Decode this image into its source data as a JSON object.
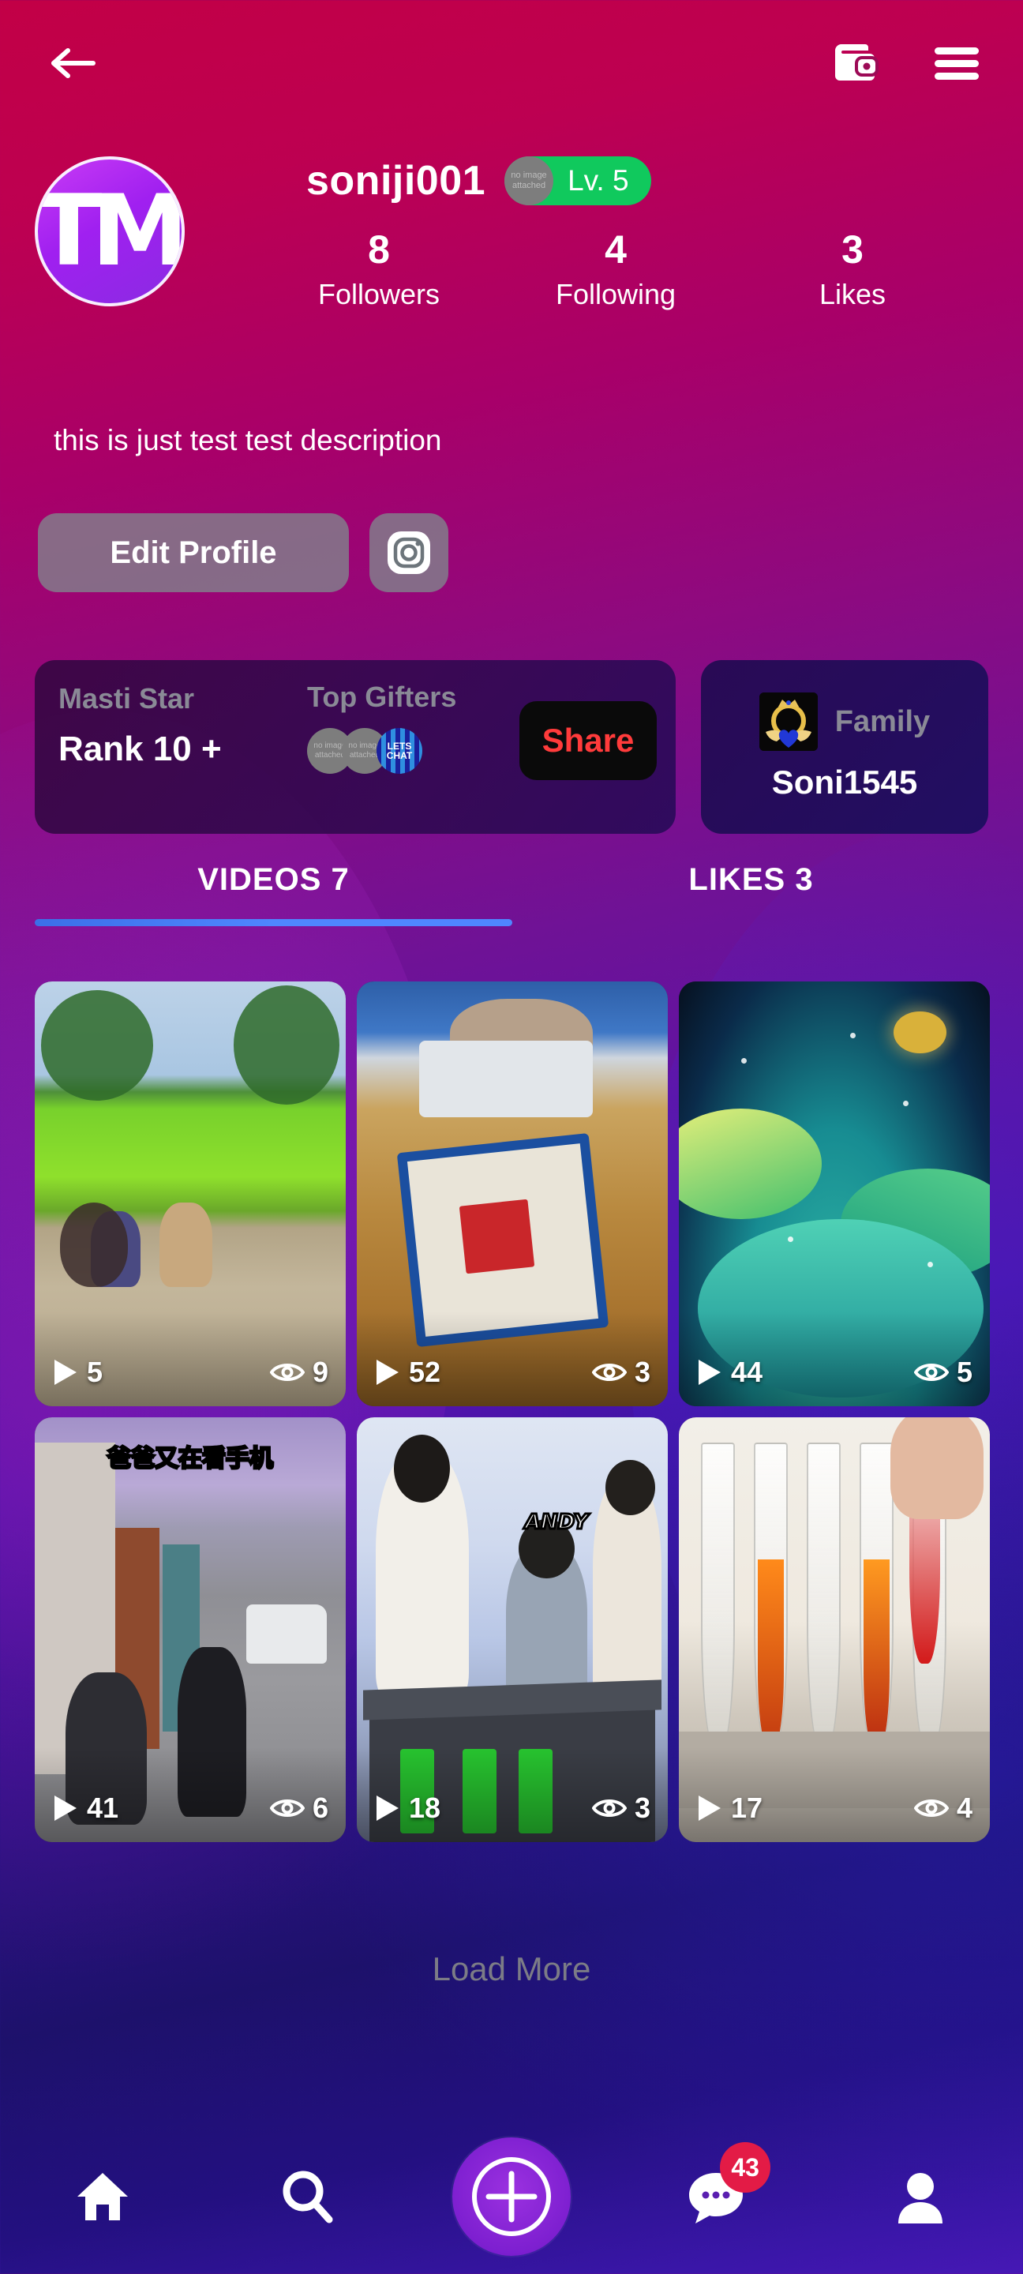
{
  "topbar": {
    "back_icon": "arrow-left-icon",
    "wallet_icon": "wallet-icon",
    "menu_icon": "hamburger-menu-icon"
  },
  "profile": {
    "avatar_monogram": "TM",
    "username": "soniji001",
    "level_badge": {
      "placeholder_line1": "no image",
      "placeholder_line2": "attached",
      "level_text": "Lv. 5",
      "color": "#10c95d"
    },
    "stats": [
      {
        "num": "8",
        "label": "Followers"
      },
      {
        "num": "4",
        "label": "Following"
      },
      {
        "num": "3",
        "label": "Likes"
      }
    ],
    "bio": "this is just test test description",
    "edit_profile_label": "Edit Profile",
    "instagram_icon": "instagram-icon"
  },
  "badges": {
    "masti": {
      "title": "Masti Star",
      "rank": "Rank 10 +"
    },
    "gifters": {
      "title": "Top Gifters",
      "avatars": [
        {
          "line1": "no image",
          "line2": "attached"
        },
        {
          "line1": "no image",
          "line2": "attached"
        },
        {
          "text": "LETS CHAT"
        }
      ]
    },
    "share_label": "Share",
    "family": {
      "emblem_icon": "crown-wings-emblem-icon",
      "label": "Family",
      "name": "Soni1545"
    }
  },
  "tabs": [
    {
      "label": "VIDEOS 7",
      "active": true
    },
    {
      "label": "LIKES 3",
      "active": false
    }
  ],
  "videos": [
    {
      "plays": "5",
      "views": "9",
      "thumb": "t-field",
      "caption": ""
    },
    {
      "plays": "52",
      "views": "3",
      "thumb": "t-machine",
      "caption": ""
    },
    {
      "plays": "44",
      "views": "5",
      "thumb": "t-lotus",
      "caption": ""
    },
    {
      "plays": "41",
      "views": "6",
      "thumb": "t-street",
      "caption": "爸爸又在看手机"
    },
    {
      "plays": "18",
      "views": "3",
      "thumb": "t-studio",
      "caption": "ANDY"
    },
    {
      "plays": "17",
      "views": "4",
      "thumb": "t-tubes",
      "caption": ""
    }
  ],
  "load_more_label": "Load More",
  "bottom_nav": [
    {
      "name": "home-icon",
      "badge": ""
    },
    {
      "name": "search-icon",
      "badge": ""
    },
    {
      "name": "add-icon",
      "badge": ""
    },
    {
      "name": "chat-icon",
      "badge": "43"
    },
    {
      "name": "profile-icon",
      "badge": ""
    }
  ],
  "colors": {
    "accent_blue": "#4f86ff",
    "badge_red": "#e31b46",
    "level_green": "#10c95d",
    "share_red": "#ff3b3b"
  }
}
